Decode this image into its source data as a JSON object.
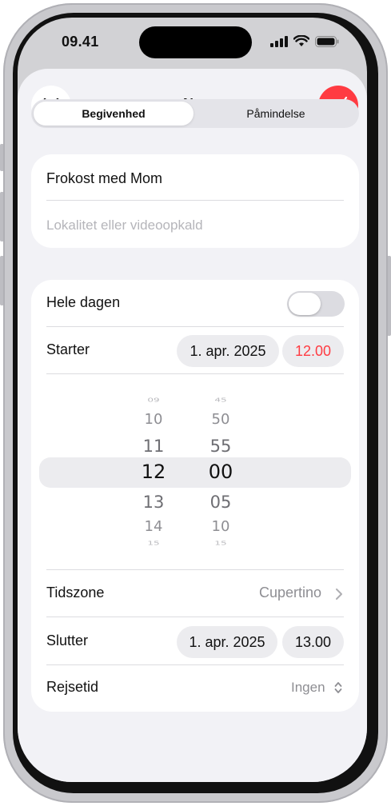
{
  "status_bar": {
    "time": "09.41"
  },
  "nav": {
    "title": "Ny",
    "close_icon": "close-icon",
    "done_icon": "checkmark-icon",
    "accent": "#ff3b42"
  },
  "segmented": {
    "options": [
      "Begivenhed",
      "Påmindelse"
    ],
    "selected": "Begivenhed"
  },
  "event": {
    "title_value": "Frokost med Mom",
    "location_placeholder": "Lokalitet eller videoopkald"
  },
  "details": {
    "all_day_label": "Hele dagen",
    "all_day_on": false,
    "starts_label": "Starter",
    "starts_date": "1. apr. 2025",
    "starts_time": "12.00",
    "picker": {
      "hours": [
        "09",
        "10",
        "11",
        "12",
        "13",
        "14",
        "15"
      ],
      "minutes": [
        "45",
        "50",
        "55",
        "00",
        "05",
        "10",
        "15"
      ],
      "selected_hour": "12",
      "selected_minute": "00"
    },
    "timezone_label": "Tidszone",
    "timezone_value": "Cupertino",
    "ends_label": "Slutter",
    "ends_date": "1. apr. 2025",
    "ends_time": "13.00",
    "travel_label": "Rejsetid",
    "travel_value": "Ingen"
  }
}
